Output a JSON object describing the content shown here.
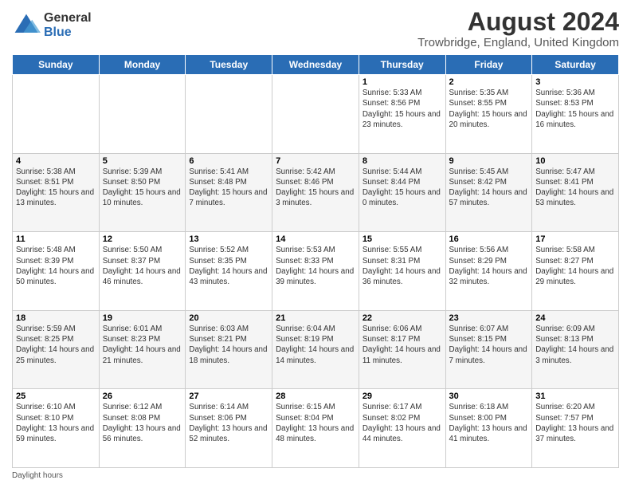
{
  "logo": {
    "general": "General",
    "blue": "Blue"
  },
  "title": "August 2024",
  "subtitle": "Trowbridge, England, United Kingdom",
  "days_of_week": [
    "Sunday",
    "Monday",
    "Tuesday",
    "Wednesday",
    "Thursday",
    "Friday",
    "Saturday"
  ],
  "footer": "Daylight hours",
  "weeks": [
    [
      {
        "day": "",
        "info": ""
      },
      {
        "day": "",
        "info": ""
      },
      {
        "day": "",
        "info": ""
      },
      {
        "day": "",
        "info": ""
      },
      {
        "day": "1",
        "info": "Sunrise: 5:33 AM\nSunset: 8:56 PM\nDaylight: 15 hours and 23 minutes."
      },
      {
        "day": "2",
        "info": "Sunrise: 5:35 AM\nSunset: 8:55 PM\nDaylight: 15 hours and 20 minutes."
      },
      {
        "day": "3",
        "info": "Sunrise: 5:36 AM\nSunset: 8:53 PM\nDaylight: 15 hours and 16 minutes."
      }
    ],
    [
      {
        "day": "4",
        "info": "Sunrise: 5:38 AM\nSunset: 8:51 PM\nDaylight: 15 hours and 13 minutes."
      },
      {
        "day": "5",
        "info": "Sunrise: 5:39 AM\nSunset: 8:50 PM\nDaylight: 15 hours and 10 minutes."
      },
      {
        "day": "6",
        "info": "Sunrise: 5:41 AM\nSunset: 8:48 PM\nDaylight: 15 hours and 7 minutes."
      },
      {
        "day": "7",
        "info": "Sunrise: 5:42 AM\nSunset: 8:46 PM\nDaylight: 15 hours and 3 minutes."
      },
      {
        "day": "8",
        "info": "Sunrise: 5:44 AM\nSunset: 8:44 PM\nDaylight: 15 hours and 0 minutes."
      },
      {
        "day": "9",
        "info": "Sunrise: 5:45 AM\nSunset: 8:42 PM\nDaylight: 14 hours and 57 minutes."
      },
      {
        "day": "10",
        "info": "Sunrise: 5:47 AM\nSunset: 8:41 PM\nDaylight: 14 hours and 53 minutes."
      }
    ],
    [
      {
        "day": "11",
        "info": "Sunrise: 5:48 AM\nSunset: 8:39 PM\nDaylight: 14 hours and 50 minutes."
      },
      {
        "day": "12",
        "info": "Sunrise: 5:50 AM\nSunset: 8:37 PM\nDaylight: 14 hours and 46 minutes."
      },
      {
        "day": "13",
        "info": "Sunrise: 5:52 AM\nSunset: 8:35 PM\nDaylight: 14 hours and 43 minutes."
      },
      {
        "day": "14",
        "info": "Sunrise: 5:53 AM\nSunset: 8:33 PM\nDaylight: 14 hours and 39 minutes."
      },
      {
        "day": "15",
        "info": "Sunrise: 5:55 AM\nSunset: 8:31 PM\nDaylight: 14 hours and 36 minutes."
      },
      {
        "day": "16",
        "info": "Sunrise: 5:56 AM\nSunset: 8:29 PM\nDaylight: 14 hours and 32 minutes."
      },
      {
        "day": "17",
        "info": "Sunrise: 5:58 AM\nSunset: 8:27 PM\nDaylight: 14 hours and 29 minutes."
      }
    ],
    [
      {
        "day": "18",
        "info": "Sunrise: 5:59 AM\nSunset: 8:25 PM\nDaylight: 14 hours and 25 minutes."
      },
      {
        "day": "19",
        "info": "Sunrise: 6:01 AM\nSunset: 8:23 PM\nDaylight: 14 hours and 21 minutes."
      },
      {
        "day": "20",
        "info": "Sunrise: 6:03 AM\nSunset: 8:21 PM\nDaylight: 14 hours and 18 minutes."
      },
      {
        "day": "21",
        "info": "Sunrise: 6:04 AM\nSunset: 8:19 PM\nDaylight: 14 hours and 14 minutes."
      },
      {
        "day": "22",
        "info": "Sunrise: 6:06 AM\nSunset: 8:17 PM\nDaylight: 14 hours and 11 minutes."
      },
      {
        "day": "23",
        "info": "Sunrise: 6:07 AM\nSunset: 8:15 PM\nDaylight: 14 hours and 7 minutes."
      },
      {
        "day": "24",
        "info": "Sunrise: 6:09 AM\nSunset: 8:13 PM\nDaylight: 14 hours and 3 minutes."
      }
    ],
    [
      {
        "day": "25",
        "info": "Sunrise: 6:10 AM\nSunset: 8:10 PM\nDaylight: 13 hours and 59 minutes."
      },
      {
        "day": "26",
        "info": "Sunrise: 6:12 AM\nSunset: 8:08 PM\nDaylight: 13 hours and 56 minutes."
      },
      {
        "day": "27",
        "info": "Sunrise: 6:14 AM\nSunset: 8:06 PM\nDaylight: 13 hours and 52 minutes."
      },
      {
        "day": "28",
        "info": "Sunrise: 6:15 AM\nSunset: 8:04 PM\nDaylight: 13 hours and 48 minutes."
      },
      {
        "day": "29",
        "info": "Sunrise: 6:17 AM\nSunset: 8:02 PM\nDaylight: 13 hours and 44 minutes."
      },
      {
        "day": "30",
        "info": "Sunrise: 6:18 AM\nSunset: 8:00 PM\nDaylight: 13 hours and 41 minutes."
      },
      {
        "day": "31",
        "info": "Sunrise: 6:20 AM\nSunset: 7:57 PM\nDaylight: 13 hours and 37 minutes."
      }
    ]
  ]
}
